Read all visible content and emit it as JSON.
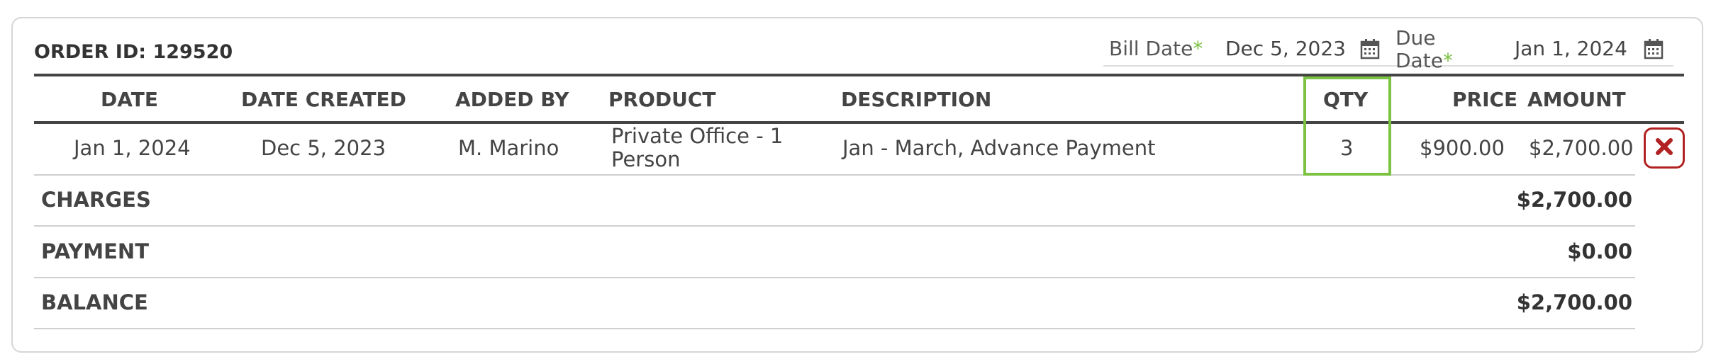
{
  "order": {
    "id_label": "ORDER ID: 129520"
  },
  "bill_date": {
    "label": "Bill Date",
    "required_mark": "*",
    "value": "Dec 5, 2023",
    "icon": "calendar-icon"
  },
  "due_date": {
    "label_line1": "Due",
    "label_line2": "Date",
    "required_mark": "*",
    "value": "Jan 1, 2024",
    "icon": "calendar-icon"
  },
  "table": {
    "headers": {
      "date": "DATE",
      "date_created": "DATE CREATED",
      "added_by": "ADDED BY",
      "product": "PRODUCT",
      "description": "DESCRIPTION",
      "qty": "QTY",
      "price": "PRICE",
      "amount": "AMOUNT"
    },
    "rows": [
      {
        "date": "Jan 1, 2024",
        "date_created": "Dec 5, 2023",
        "added_by": "M. Marino",
        "product_line1": "Private Office - 1",
        "product_line2": "Person",
        "description": "Jan - March, Advance Payment",
        "qty": "3",
        "price": "$900.00",
        "amount": "$2,700.00",
        "delete_icon": "close-icon"
      }
    ]
  },
  "summary": {
    "charges": {
      "label": "CHARGES",
      "value": "$2,700.00"
    },
    "payment": {
      "label": "PAYMENT",
      "value": "$0.00"
    },
    "balance": {
      "label": "BALANCE",
      "value": "$2,700.00"
    }
  },
  "colors": {
    "required": "#7cc243",
    "qty_highlight": "#7cc243",
    "delete": "#b22222",
    "border": "#d6d6d6"
  }
}
